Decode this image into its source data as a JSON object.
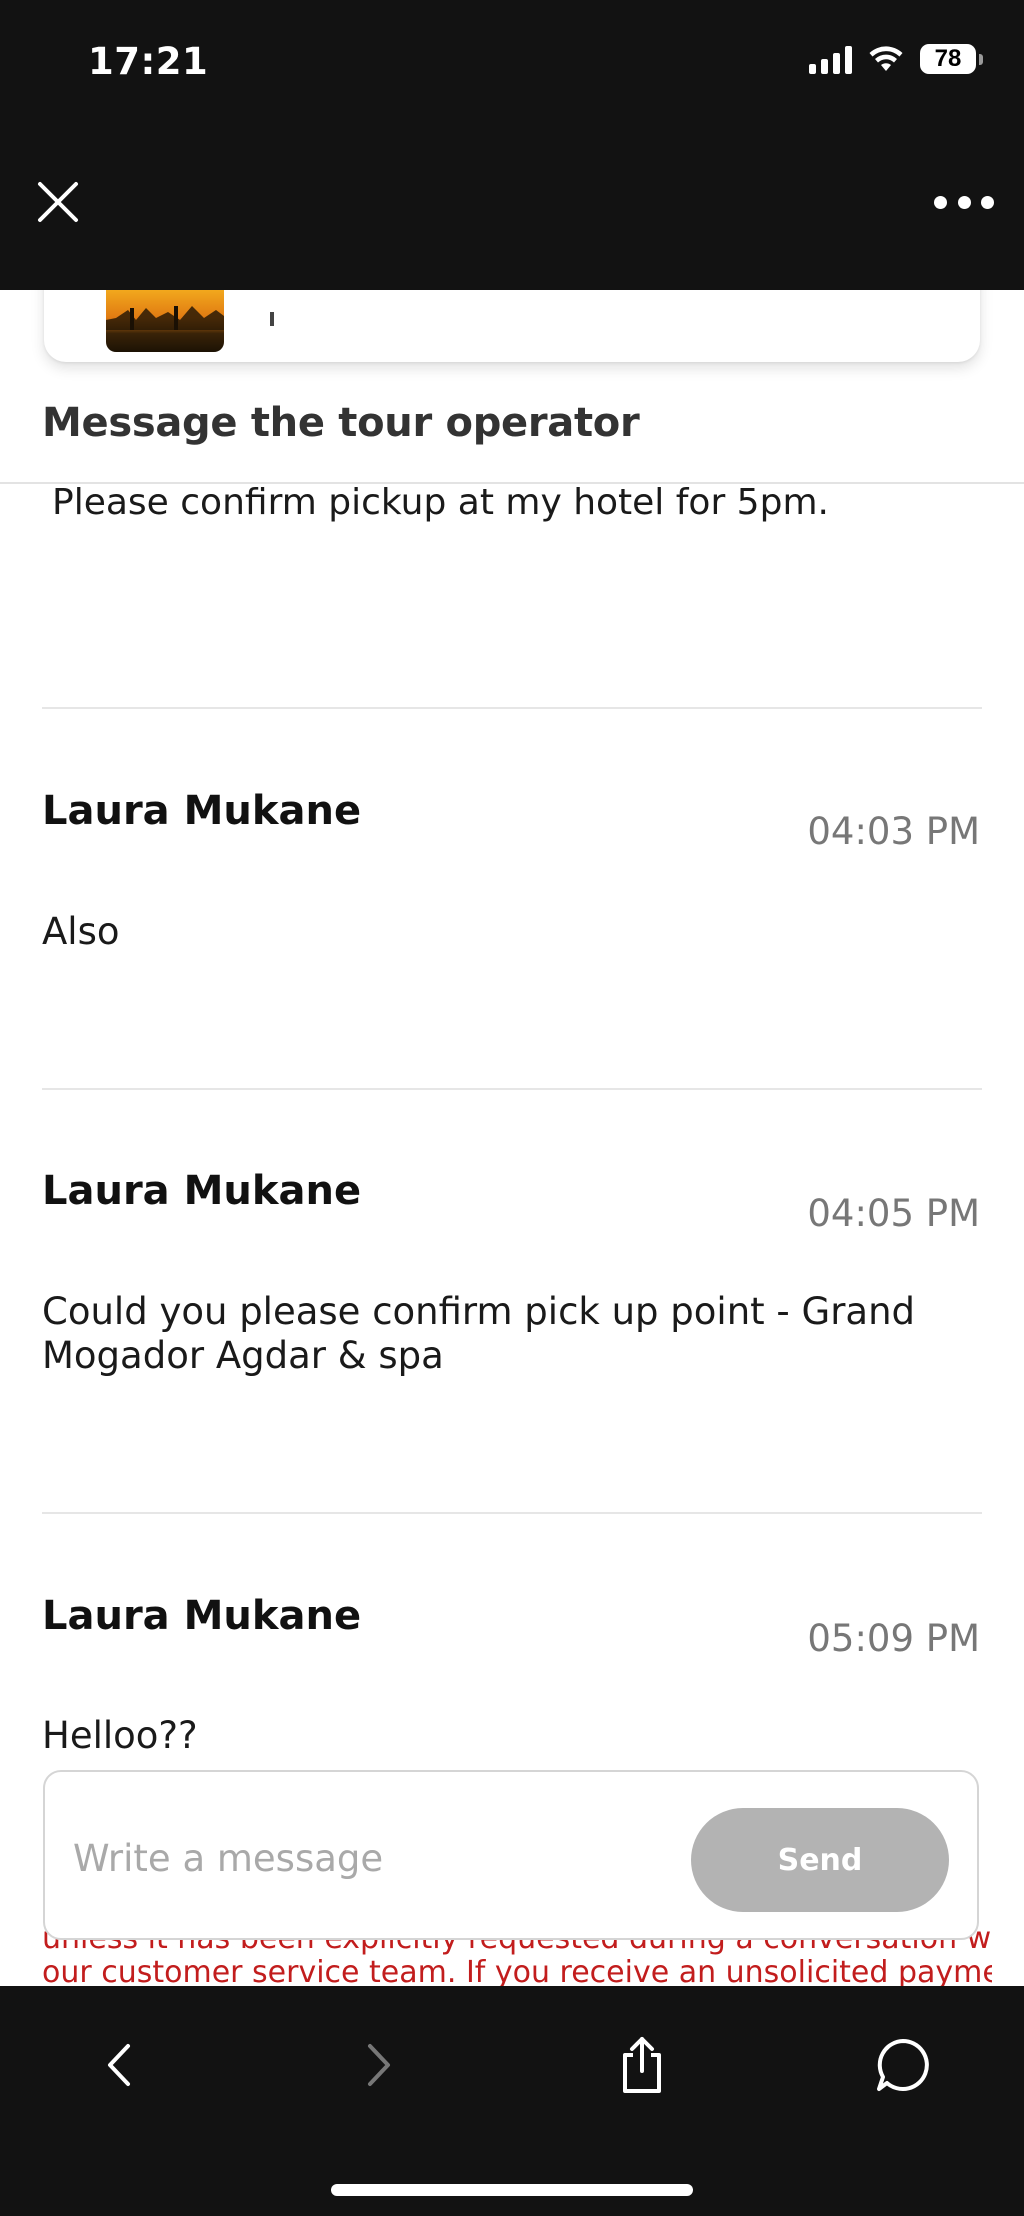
{
  "status_bar": {
    "time": "17:21",
    "battery": "78"
  },
  "section": {
    "title": "Message the tour operator"
  },
  "messages": [
    {
      "body": "Please confirm pickup at my hotel for 5pm."
    },
    {
      "author": "Laura Mukane",
      "time": "04:03 PM",
      "body": "Also"
    },
    {
      "author": "Laura Mukane",
      "time": "04:05 PM",
      "body": "Could you please confirm pick up point - Grand Mogador Agdar & spa"
    },
    {
      "author": "Laura Mukane",
      "time": "05:09 PM",
      "body": "Helloo??"
    }
  ],
  "composer": {
    "placeholder": "Write a message",
    "send_label": "Send"
  },
  "disclaimer": {
    "line1": "unless it has been explicitly requested during a conversation with",
    "line2": "our customer service team. If you receive an unsolicited payment"
  },
  "colors": {
    "bar_bg": "#121212",
    "send_disabled": "#b3b3b3",
    "warning": "#c21d1d"
  }
}
